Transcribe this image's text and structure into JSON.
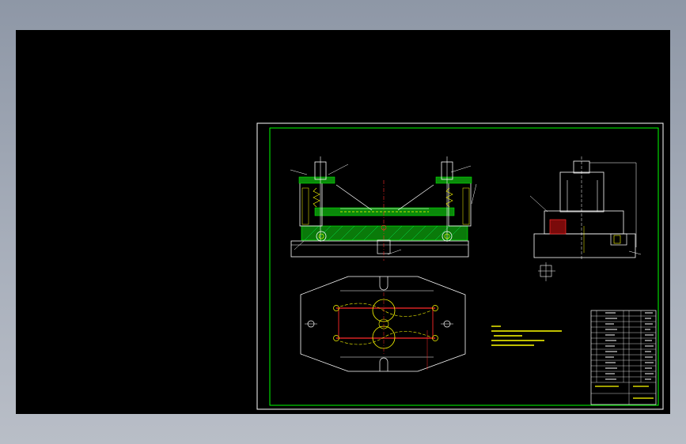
{
  "colors": {
    "background_outer": "#a0a8b4",
    "canvas": "#000000",
    "frame_white": "#ffffff",
    "frame_green": "#00ff00",
    "outline_white": "#ffffff",
    "yellow": "#ffff00",
    "red": "#ff2a2a",
    "hatch_green": "#00c000",
    "magenta": "#ff00ff"
  },
  "views": [
    {
      "name": "front-section-view"
    },
    {
      "name": "side-view"
    },
    {
      "name": "top-view"
    }
  ]
}
